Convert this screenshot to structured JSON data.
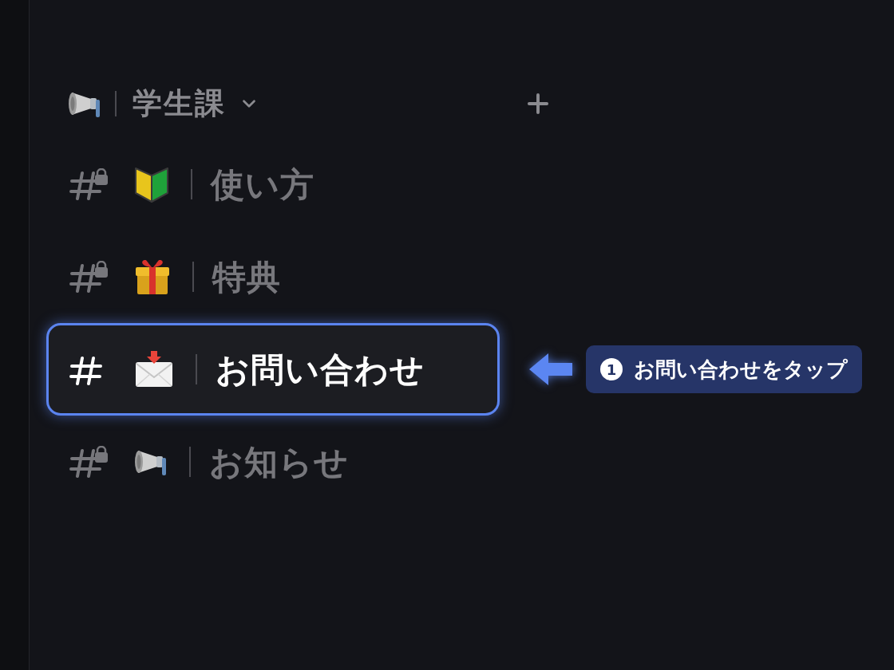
{
  "category": {
    "name": "学生課",
    "expanded": true
  },
  "channels": [
    {
      "name": "使い方",
      "locked": true,
      "selected": false
    },
    {
      "name": "特典",
      "locked": true,
      "selected": false
    },
    {
      "name": "お問い合わせ",
      "locked": false,
      "selected": true
    },
    {
      "name": "お知らせ",
      "locked": true,
      "selected": false
    }
  ],
  "callout": {
    "step": "1",
    "text": "お問い合わせをタップ"
  }
}
